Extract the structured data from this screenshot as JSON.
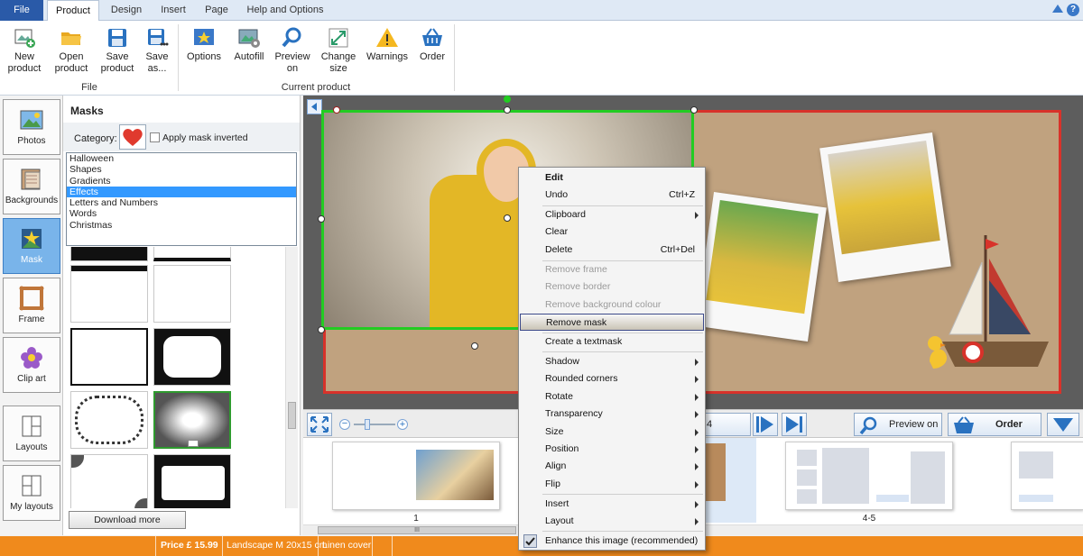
{
  "tabs": {
    "file": "File",
    "product": "Product",
    "design": "Design",
    "insert": "Insert",
    "page": "Page",
    "help": "Help and Options"
  },
  "ribbon": {
    "new_product": [
      "New",
      "product"
    ],
    "open_product": [
      "Open",
      "product"
    ],
    "save_product": [
      "Save",
      "product"
    ],
    "save_as": [
      "Save",
      "as..."
    ],
    "options": "Options",
    "autofill": "Autofill",
    "preview_on": [
      "Preview",
      "on"
    ],
    "change_size": [
      "Change",
      "size"
    ],
    "warnings": "Warnings",
    "order": "Order",
    "group_file": "File",
    "group_current": "Current product"
  },
  "left_tools": [
    "Photos",
    "Backgrounds",
    "Mask",
    "Frame",
    "Clip art",
    "Layouts",
    "My layouts"
  ],
  "masks": {
    "title": "Masks",
    "category_label": "Category:",
    "apply_inverted": "Apply mask inverted",
    "categories": [
      "Halloween",
      "Shapes",
      "Gradients",
      "Effects",
      "Letters and Numbers",
      "Words",
      "Christmas"
    ],
    "selected_index": 3,
    "download_more": "Download more"
  },
  "navbar": {
    "preview_on": "Preview on",
    "order": "Order",
    "page_partial": "4"
  },
  "filmstrip": {
    "labels": [
      "1",
      "4-5"
    ],
    "scroll_grip": "III"
  },
  "status": {
    "price": "Price £ 15.99",
    "format": "Landscape M 20x15 cm",
    "cover": "Linen cover"
  },
  "context_menu": {
    "edit": "Edit",
    "undo": "Undo",
    "undo_sc": "Ctrl+Z",
    "clipboard": "Clipboard",
    "clear": "Clear",
    "delete": "Delete",
    "delete_sc": "Ctrl+Del",
    "remove_frame": "Remove frame",
    "remove_border": "Remove border",
    "remove_bg": "Remove background colour",
    "remove_mask": "Remove mask",
    "create_textmask": "Create a textmask",
    "shadow": "Shadow",
    "rounded": "Rounded corners",
    "rotate": "Rotate",
    "transparency": "Transparency",
    "size": "Size",
    "position": "Position",
    "align": "Align",
    "flip": "Flip",
    "insert": "Insert",
    "layout": "Layout",
    "enhance": "Enhance this image (recommended)"
  },
  "colors": {
    "status_orange": "#f08a1c",
    "selection_green": "#22cc22",
    "page_border_red": "#d8322a",
    "tab_file_blue": "#2a5aa8"
  }
}
